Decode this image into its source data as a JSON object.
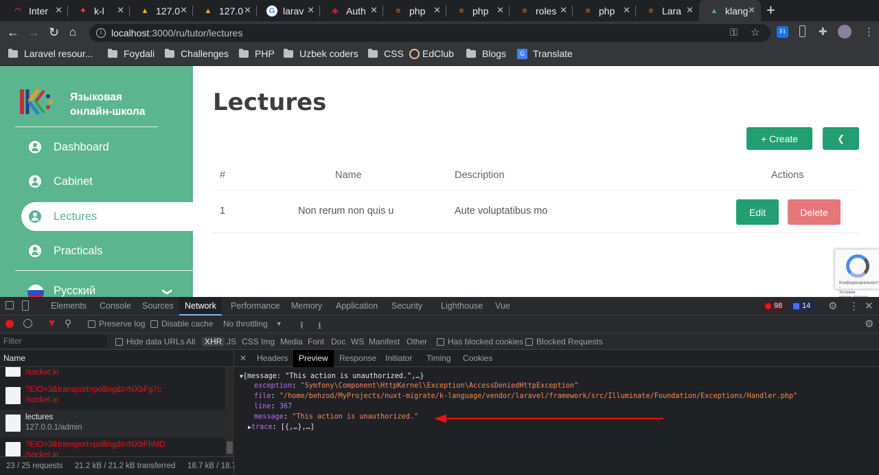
{
  "browser": {
    "tabs": [
      {
        "label": "Inter",
        "color": "#d93025",
        "glyph": "◠"
      },
      {
        "label": "k-l",
        "color": "#ff3e3e",
        "glyph": "✦"
      },
      {
        "label": "127.0",
        "color": "#f4b400",
        "glyph": "▲"
      },
      {
        "label": "127.0",
        "color": "#f4b400",
        "glyph": "▲"
      },
      {
        "label": "larav",
        "color": "#4285f4",
        "glyph": "G"
      },
      {
        "label": "Auth",
        "color": "#c5192d",
        "glyph": "◆"
      },
      {
        "label": "php",
        "color": "#f48024",
        "glyph": "≡"
      },
      {
        "label": "php",
        "color": "#f48024",
        "glyph": "≡"
      },
      {
        "label": "roles",
        "color": "#f48024",
        "glyph": "≡"
      },
      {
        "label": "php",
        "color": "#f48024",
        "glyph": "≡"
      },
      {
        "label": "Lara",
        "color": "#f48024",
        "glyph": "≡"
      },
      {
        "label": "klang",
        "color": "#41b883",
        "glyph": "▲"
      }
    ],
    "new_tab": "+",
    "url_host": "localhost",
    "url_path": ":3000/ru/tutor/lectures",
    "bookmarks": [
      "Laravel resour...",
      "Foydali",
      "Challenges",
      "PHP",
      "Uzbek coders",
      "CSS",
      "EdClub",
      "Blogs",
      "Translate"
    ]
  },
  "sidebar": {
    "brand_line1": "Языковая",
    "brand_line2": "онлайн-школа",
    "items": [
      {
        "label": "Dashboard"
      },
      {
        "label": "Cabinet"
      },
      {
        "label": "Lectures"
      },
      {
        "label": "Practicals"
      }
    ],
    "language": "Русский"
  },
  "main": {
    "title": "Lectures",
    "create_label": "+ Create",
    "table_headers": {
      "num": "#",
      "name": "Name",
      "description": "Description",
      "actions": "Actions"
    },
    "rows": [
      {
        "num": "1",
        "name": "Non rerum non quis u",
        "description": "Aute voluptatibus mo",
        "edit": "Edit",
        "delete": "Delete"
      }
    ],
    "captcha_text_1": "Конфиденциальность -",
    "captcha_text_2": "Условия использования"
  },
  "devtools": {
    "tabs": [
      "Elements",
      "Console",
      "Sources",
      "Network",
      "Performance",
      "Memory",
      "Application",
      "Security",
      "Lighthouse",
      "Vue"
    ],
    "errors": "98",
    "messages": "14",
    "preserve_log": "Preserve log",
    "disable_cache": "Disable cache",
    "throttling": "No throttling",
    "filter_placeholder": "Filter",
    "hide_data_urls": "Hide data URLs",
    "filter_types": [
      "All",
      "XHR",
      "JS",
      "CSS",
      "Img",
      "Media",
      "Font",
      "Doc",
      "WS",
      "Manifest",
      "Other"
    ],
    "has_blocked_cookies": "Has blocked cookies",
    "blocked_requests": "Blocked Requests",
    "name_col": "Name",
    "requests": [
      {
        "line1": "",
        "line2": "/socket.io",
        "error": true
      },
      {
        "line1": "?EIO=3&transport=polling&t=NXbFg7c",
        "line2": "/socket.io",
        "error": true
      },
      {
        "line1": "lectures",
        "line2": "127.0.0.1/admin",
        "error": false
      },
      {
        "line1": "?EIO=3&transport=polling&t=NXbFhMD",
        "line2": "/socket.io",
        "error": true
      }
    ],
    "status_requests": "23 / 25 requests",
    "status_transferred": "21.2 kB / 21.2 kB transferred",
    "status_resources": "18.7 kB / 18.7",
    "sub_tabs": [
      "Headers",
      "Preview",
      "Response",
      "Initiator",
      "Timing",
      "Cookies"
    ],
    "preview": {
      "summary": "{message: \"This action is unauthorized.\",…}",
      "exception_key": "exception",
      "exception_val": "\"Symfony\\Component\\HttpKernel\\Exception\\AccessDeniedHttpException\"",
      "file_key": "file",
      "file_val": "\"/home/behzod/MyProjects/nuxt-migrate/k-language/vendor/laravel/framework/src/Illuminate/Foundation/Exceptions/Handler.php\"",
      "line_key": "line",
      "line_val": "367",
      "message_key": "message",
      "message_val": "\"This action is unauthorized.\"",
      "trace_key": "trace",
      "trace_val": "[{,…},…]"
    },
    "arrow_color": "#e8141c"
  }
}
